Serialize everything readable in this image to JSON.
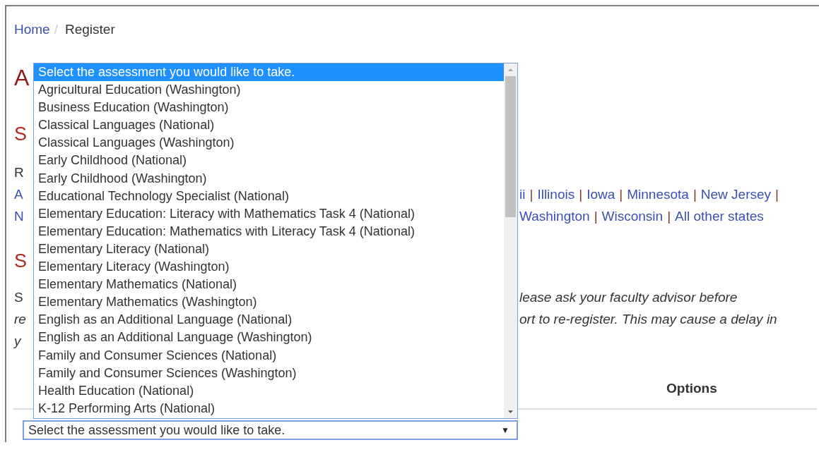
{
  "breadcrumb": {
    "items": [
      {
        "label": "Home",
        "kind": "link"
      },
      {
        "label": "Register",
        "kind": "current"
      }
    ],
    "separator": "/"
  },
  "page_title": "A",
  "section_1": {
    "heading": "S",
    "intro": "R",
    "link_lines": [
      {
        "left": "A",
        "right": [
          {
            "kind": "link",
            "text": "ii"
          },
          {
            "kind": "separator",
            "text": "|"
          },
          {
            "kind": "link",
            "text": "Illinois"
          },
          {
            "kind": "separator",
            "text": "|"
          },
          {
            "kind": "link",
            "text": "Iowa"
          },
          {
            "kind": "separator",
            "text": "|"
          },
          {
            "kind": "link",
            "text": "Minnesota"
          },
          {
            "kind": "separator",
            "text": "|"
          },
          {
            "kind": "link",
            "text": "New Jersey"
          },
          {
            "kind": "separator",
            "text": "|"
          }
        ]
      },
      {
        "left": "N",
        "right": [
          {
            "kind": "link",
            "text": "Washington"
          },
          {
            "kind": "separator",
            "text": "|"
          },
          {
            "kind": "link",
            "text": "Wisconsin"
          },
          {
            "kind": "separator",
            "text": "|"
          },
          {
            "kind": "link",
            "text": "All other states"
          }
        ]
      }
    ]
  },
  "section_2": {
    "heading": "S",
    "note_lines": [
      {
        "left": "S",
        "left_italic": false,
        "right": "lease ask your faculty advisor before"
      },
      {
        "left": "re",
        "left_italic": true,
        "right": "ort to re-register. This may cause a delay in"
      },
      {
        "left": "y",
        "left_italic": true
      }
    ]
  },
  "table": {
    "headers": [
      "Options"
    ]
  },
  "select": {
    "value": "Select the assessment you would like to take.",
    "caret": "▼"
  },
  "dropdown": {
    "options": [
      {
        "label": "Select the assessment you would like to take.",
        "selected": true
      },
      {
        "label": "Agricultural Education (Washington)",
        "selected": false
      },
      {
        "label": "Business Education (Washington)",
        "selected": false
      },
      {
        "label": "Classical Languages (National)",
        "selected": false
      },
      {
        "label": "Classical Languages (Washington)",
        "selected": false
      },
      {
        "label": "Early Childhood (National)",
        "selected": false
      },
      {
        "label": "Early Childhood (Washington)",
        "selected": false
      },
      {
        "label": "Educational Technology Specialist (National)",
        "selected": false
      },
      {
        "label": "Elementary Education: Literacy with Mathematics Task 4 (National)",
        "selected": false
      },
      {
        "label": "Elementary Education: Mathematics with Literacy Task 4 (National)",
        "selected": false
      },
      {
        "label": "Elementary Literacy (National)",
        "selected": false
      },
      {
        "label": "Elementary Literacy (Washington)",
        "selected": false
      },
      {
        "label": "Elementary Mathematics (National)",
        "selected": false
      },
      {
        "label": "Elementary Mathematics (Washington)",
        "selected": false
      },
      {
        "label": "English as an Additional Language (National)",
        "selected": false
      },
      {
        "label": "English as an Additional Language (Washington)",
        "selected": false
      },
      {
        "label": "Family and Consumer Sciences (National)",
        "selected": false
      },
      {
        "label": "Family and Consumer Sciences (Washington)",
        "selected": false
      },
      {
        "label": "Health Education (National)",
        "selected": false
      },
      {
        "label": "K-12 Performing Arts (National)",
        "selected": false
      }
    ]
  }
}
